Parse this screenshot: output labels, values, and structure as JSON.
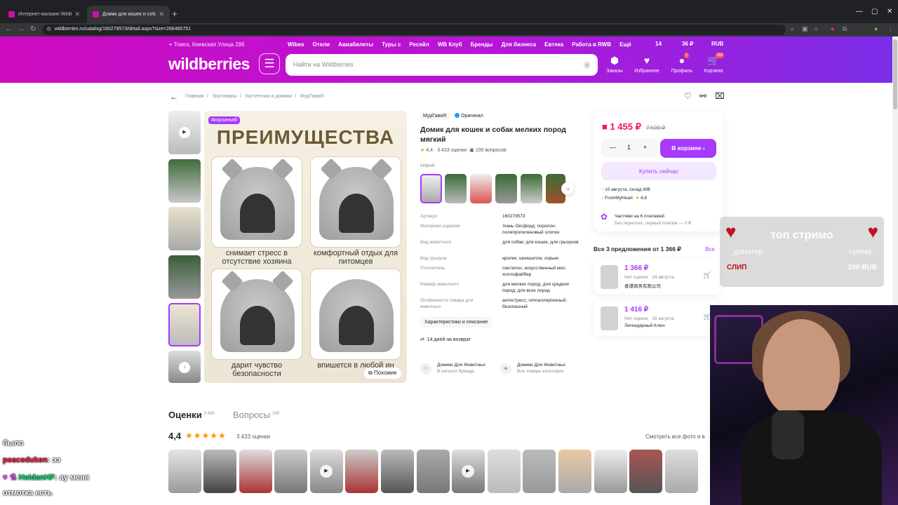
{
  "browser": {
    "tabs": [
      {
        "label": "Интернет-магазин Wildberries"
      },
      {
        "label": "Домик для кошек и собак ме..."
      }
    ],
    "url": "wildberries.ru/catalog/160279573/detail.aspx?size=266465751"
  },
  "header": {
    "location": "Томск, Киевская Улица 28б",
    "nav": [
      "Wibes",
      "Отели",
      "Авиабилеты",
      "Туры с ",
      "Ресейл",
      "WB Клуб",
      "Бренды",
      "Для бизнеса",
      "Евтека",
      "Работа в RWB",
      "Ещё"
    ],
    "stat1": "14",
    "stat2": "36 ₽",
    "currency": "RUB",
    "logo": "wildberries",
    "search_placeholder": "Найти на Wildberries",
    "icons": [
      {
        "label": "Заказы"
      },
      {
        "label": "Избранное"
      },
      {
        "label": "Профиль",
        "badge": "1"
      },
      {
        "label": "Корзина",
        "badge": "292"
      }
    ]
  },
  "breadcrumbs": [
    "Главная",
    "Зоотовары",
    "Когтеточки и домики",
    "МурГавиЯ"
  ],
  "gallery": {
    "hashtag": "#корзинкаб",
    "title": "ПРЕИМУЩЕСТВА",
    "captions": [
      "снимает стресс в отсутствие хозяина",
      "комфортный отдых для питомцев",
      "дарит чувство безопасности",
      "впишется в любой ин"
    ],
    "similar": "Похожие"
  },
  "product": {
    "brand": "МурГавиЯ",
    "original": "Оригинал",
    "title": "Домик для кошек и собак мелких пород мягкий",
    "rating": "4,4",
    "reviews": "3 433 оценки",
    "questions": "100 вопросов",
    "color_label": "серый",
    "specs": [
      {
        "k": "Артикул",
        "v": "160279573"
      },
      {
        "k": "Материал изделия",
        "v": "ткань Оксфорд; поролон; полипропиленовый хлопок"
      },
      {
        "k": "Вид животного",
        "v": "для собак; для кошек; для грызунов"
      },
      {
        "k": "Вид грызуна",
        "v": "кролик; шиншилла; хорьки"
      },
      {
        "k": "Утеплитель",
        "v": "синтепон; искусственный мех; холлофайбер"
      },
      {
        "k": "Размер животного",
        "v": "для мелких пород; для средних пород; для всех пород"
      },
      {
        "k": "Особенности товара для животных",
        "v": "антистресс; гипоаллергенный; безопасный"
      }
    ],
    "char_button": "Характеристики и описание",
    "return": "14 дней на возврат",
    "brand_cards": [
      {
        "t": "Домики Для Животных",
        "s": "В каталог бренда"
      },
      {
        "t": "Домики Для Животных",
        "s": "Все товары категории"
      }
    ]
  },
  "buybox": {
    "price": "1 455 ₽",
    "old_price": "7 500 ₽",
    "qty": "1",
    "cart": "В корзине",
    "buy_now": "Купить сейчас",
    "delivery": "10 августа, склад WB",
    "seller": "FromMyHeart",
    "seller_rating": "4,6",
    "installment": "Частями на 6 платежей",
    "installment_sub": "Без переплат, первый платёж — 0 ₽"
  },
  "offers": {
    "title": "Все 3 предложения от 1 366 ₽",
    "all": "Все",
    "items": [
      {
        "price": "1 366 ₽",
        "rating": "Нет оценок",
        "date": "24 августа",
        "seller": "香港商务有限公司"
      },
      {
        "price": "1 416 ₽",
        "rating": "Нет оценок",
        "date": "28 августа",
        "seller": "Легендарный Ключ"
      }
    ]
  },
  "reviews": {
    "tab1": "Оценки",
    "tab1_count": "3 433",
    "tab2": "Вопросы",
    "tab2_count": "100",
    "rating": "4,4",
    "stars": "★★★★★",
    "count": "3 433 оценки",
    "see_all": "Смотреть все фото и в"
  },
  "donation": {
    "title": "топ стримо",
    "left": "донатер",
    "right": "сумма",
    "name": "СЛИП",
    "amount": "200 RUB"
  },
  "chat": [
    {
      "name": "",
      "text": "было"
    },
    {
      "name": "peaceduken",
      "text": ": ээ"
    },
    {
      "name": "HeidanHF",
      "text": ": ау меня"
    },
    {
      "name": "",
      "text": "отмотка есть"
    }
  ],
  "colors": {
    "accent": "#a73afd",
    "price": "#f91155",
    "header_start": "#ce0bc0",
    "header_end": "#7a2ee8"
  }
}
